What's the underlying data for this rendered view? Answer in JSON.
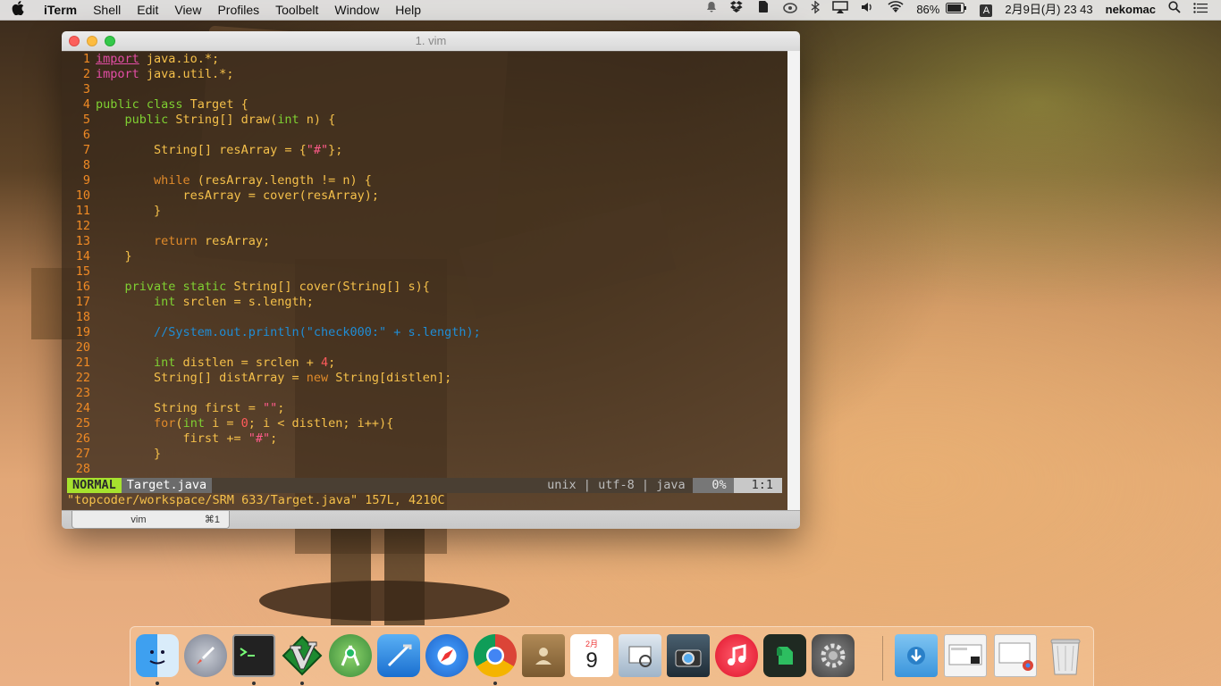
{
  "menubar": {
    "app_name": "iTerm",
    "menus": [
      "Shell",
      "Edit",
      "View",
      "Profiles",
      "Toolbelt",
      "Window",
      "Help"
    ],
    "battery": "86%",
    "ime": "A",
    "datetime": "2月9日(月)  23 43",
    "user": "nekomac"
  },
  "window": {
    "title": "1. vim",
    "tab": {
      "name": "vim",
      "shortcut": "⌘1"
    }
  },
  "editor": {
    "lines": [
      "1",
      "2",
      "3",
      "4",
      "5",
      "6",
      "7",
      "8",
      "9",
      "10",
      "11",
      "12",
      "13",
      "14",
      "15",
      "16",
      "17",
      "18",
      "19",
      "20",
      "21",
      "22",
      "23",
      "24",
      "25",
      "26",
      "27",
      "28"
    ],
    "code": {
      "l1_kw": "import",
      "l1_rest": " java.io.*;",
      "l2_kw": "import",
      "l2_rest": " java.util.*;",
      "l4_kw": "public class",
      "l4_rest": " Target {",
      "l5_kw": "public",
      "l5_ty": " String[]",
      "l5_a": " draw(",
      "l5_int": "int",
      "l5_b": " n) {",
      "l7_a": "String[] resArray = {",
      "l7_str": "\"#\"",
      "l7_b": "};",
      "l9_kw": "while",
      "l9_rest": " (resArray.length != n) {",
      "l10": "resArray = cover(resArray);",
      "l11": "}",
      "l13_kw": "return",
      "l13_rest": " resArray;",
      "l14": "}",
      "l16_kw": "private static",
      "l16_ty": " String[]",
      "l16_rest": " cover(String[] s){",
      "l17_ty": "int",
      "l17_rest": " srclen = s.length;",
      "l19": "//System.out.println(\"check000:\" + s.length);",
      "l21_ty": "int",
      "l21_a": " distlen = srclen + ",
      "l21_num": "4",
      "l21_b": ";",
      "l22_a": "String[] distArray = ",
      "l22_kw": "new",
      "l22_b": " String[distlen];",
      "l24_a": "String first = ",
      "l24_str": "\"\"",
      "l24_b": ";",
      "l25_kw": "for",
      "l25_a": "(",
      "l25_ty": "int",
      "l25_b": " i = ",
      "l25_num": "0",
      "l25_c": "; i < distlen; i++){",
      "l26_a": "first += ",
      "l26_str": "\"#\"",
      "l26_b": ";",
      "l27": "}"
    }
  },
  "statusline": {
    "mode": "NORMAL",
    "file": "Target.java",
    "info": "unix | utf-8 | java",
    "percent": "0%",
    "position": "1:1"
  },
  "cmdline": "\"topcoder/workspace/SRM 633/Target.java\" 157L, 4210C",
  "dock": {
    "apps": [
      "Finder",
      "Launchpad",
      "Terminal",
      "Vim",
      "Android Studio",
      "Xcode",
      "Safari",
      "Chrome",
      "Contacts",
      "Calendar",
      "Preview",
      "Image Capture",
      "iTunes",
      "Evernote",
      "System Preferences",
      "Downloads",
      "Documents",
      "Recent",
      "Trash"
    ],
    "calendar_month": "2月",
    "calendar_day": "9"
  }
}
